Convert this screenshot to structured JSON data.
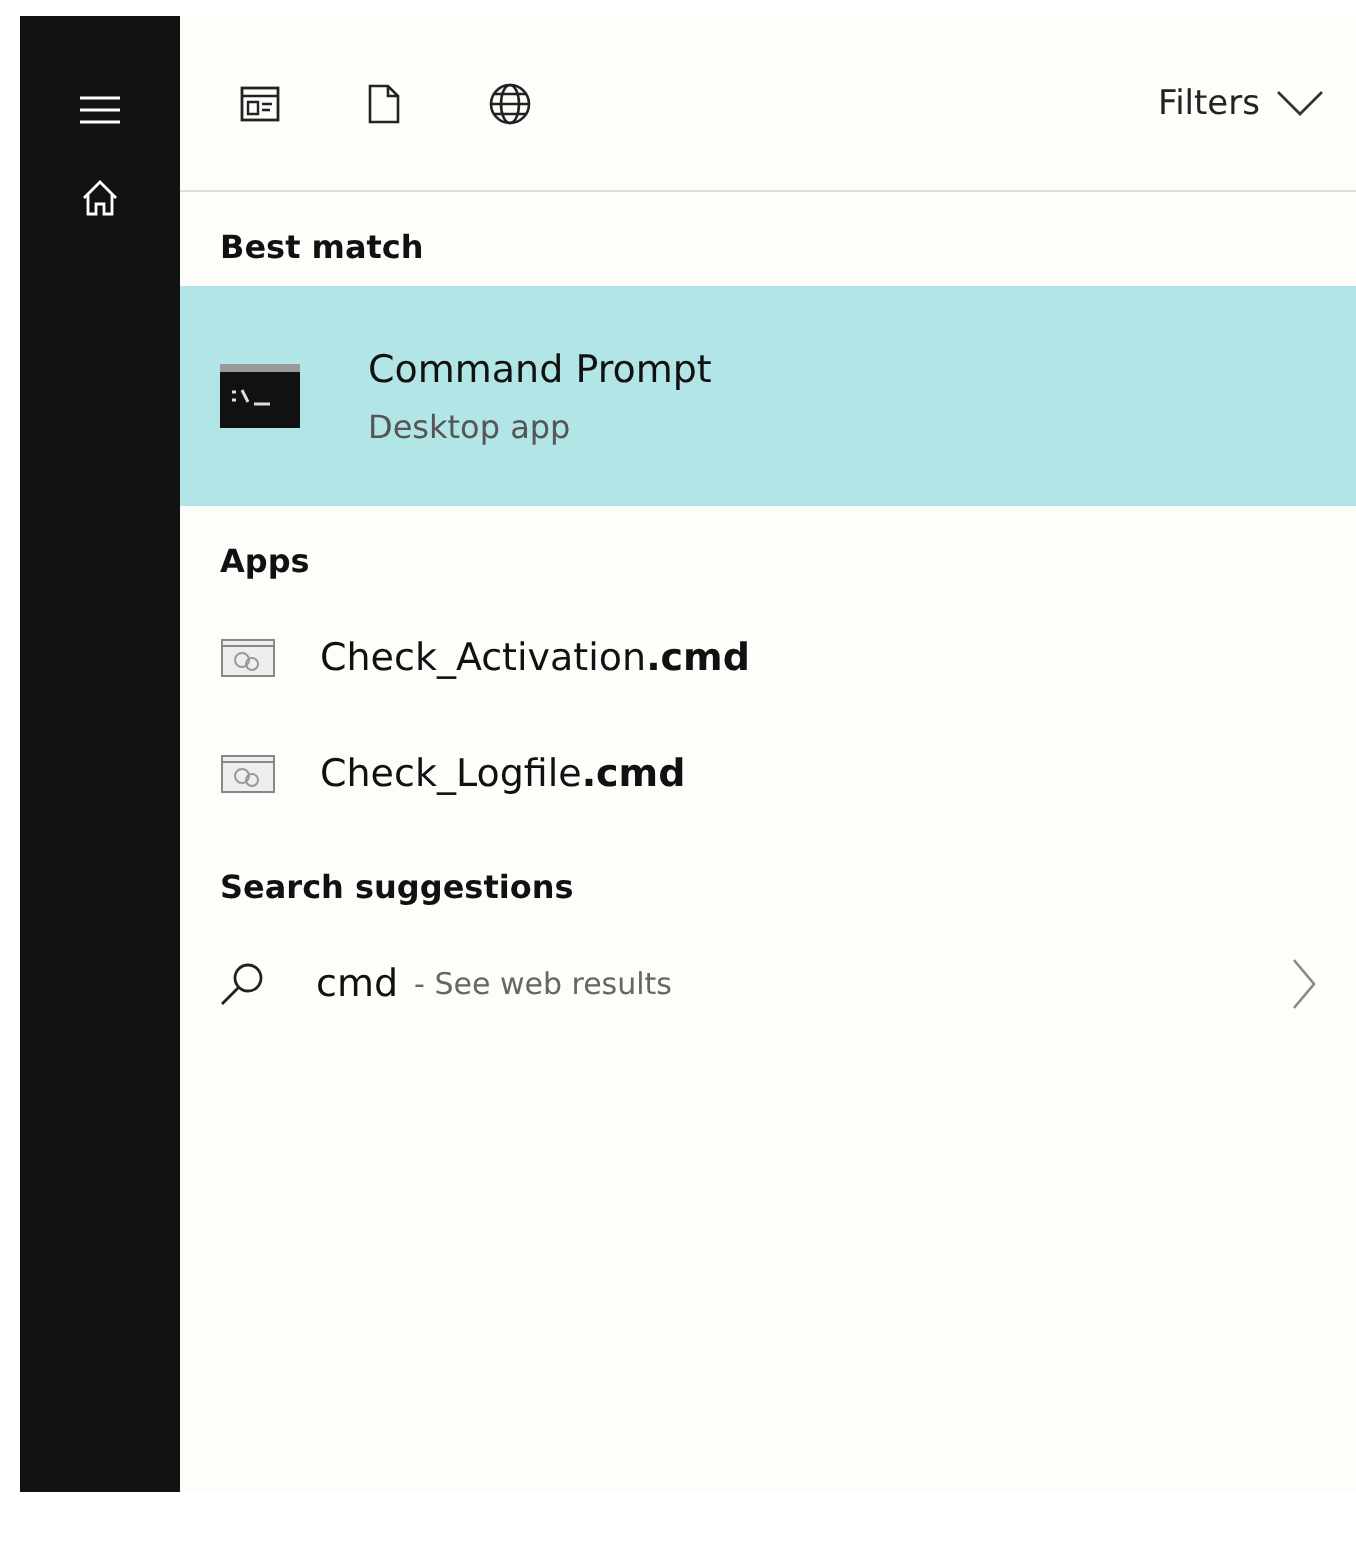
{
  "toolbar": {
    "filters_label": "Filters"
  },
  "sections": [
    {
      "heading": "Best match",
      "kind": "app",
      "items": [
        {
          "title": "Command Prompt",
          "subtitle": "Desktop app",
          "selected": true
        }
      ]
    },
    {
      "heading": "Apps",
      "kind": "file",
      "items": [
        {
          "title": "Check_Activation**.cmd**",
          "selected": false
        },
        {
          "title": "Check_Logfile**.cmd**",
          "selected": false
        }
      ]
    },
    {
      "heading": "Search suggestions",
      "kind": "web",
      "items": [
        {
          "title": "cmd",
          "subtitle": "- See web results",
          "selected": false
        }
      ]
    }
  ]
}
